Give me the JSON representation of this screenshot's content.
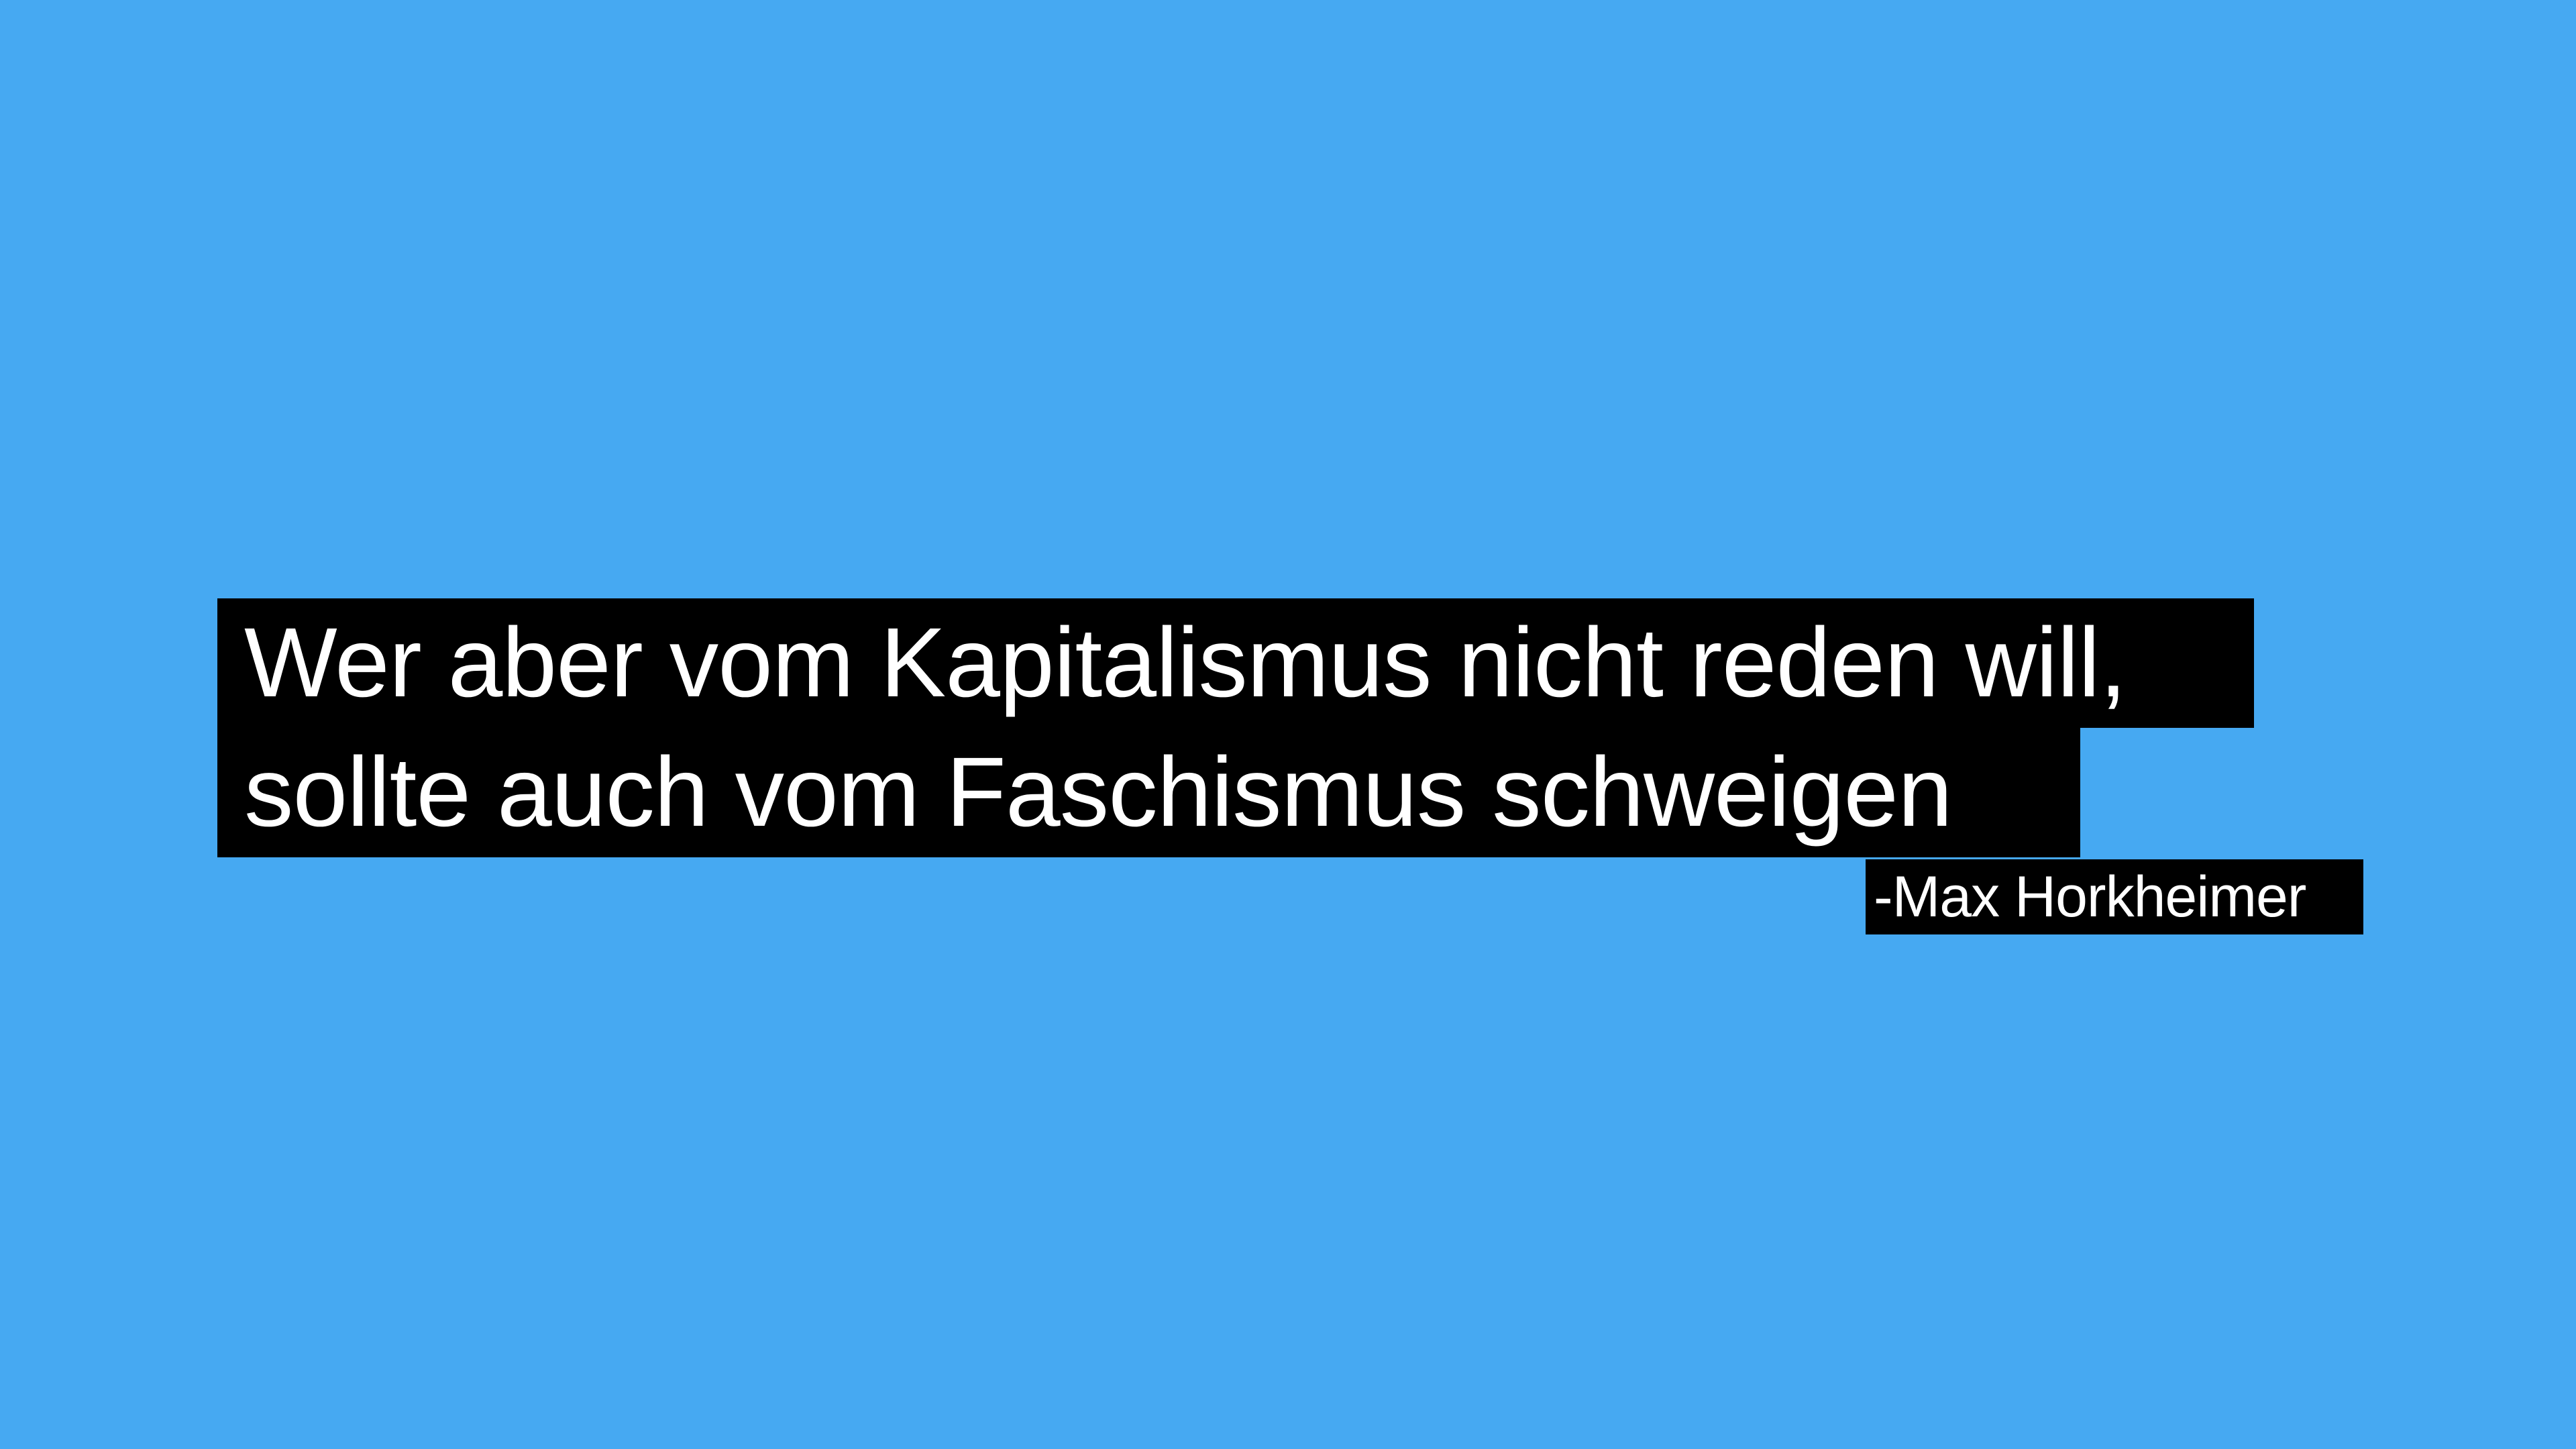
{
  "quote": {
    "line_1": "Wer aber vom Kapitalismus nicht reden will,",
    "line_2": "sollte auch vom Faschismus schweigen",
    "attribution": "-Max Horkheimer"
  },
  "colors": {
    "background": "#46a9f2",
    "text_highlight": "#000000",
    "text": "#ffffff"
  }
}
